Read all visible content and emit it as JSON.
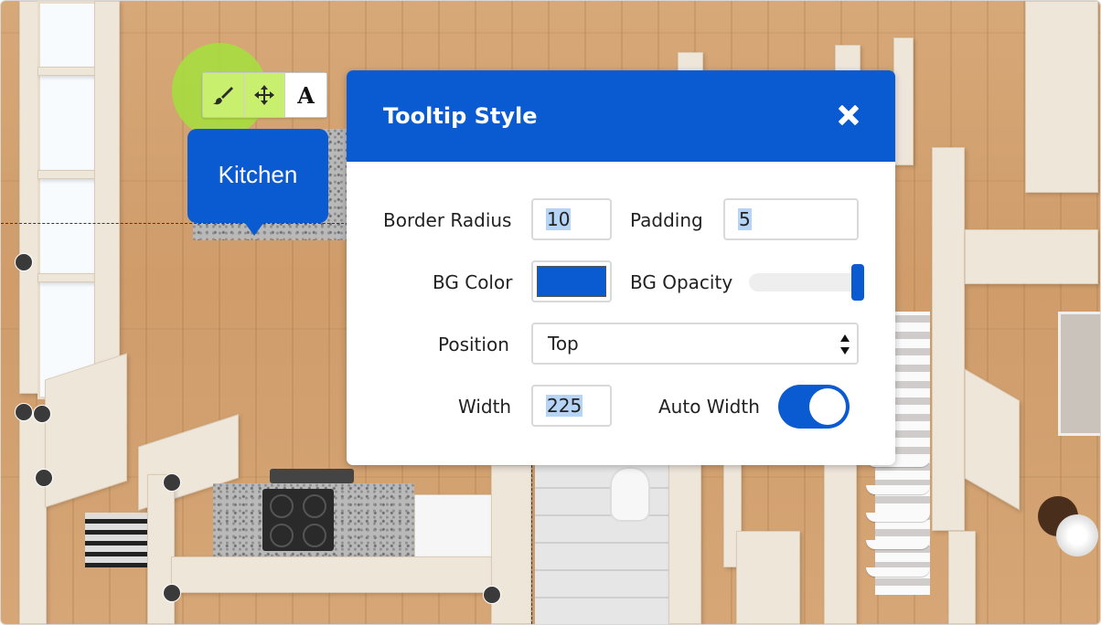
{
  "toolbar": {
    "style_icon": "paintbrush-icon",
    "move_icon": "move-arrows-icon",
    "text_label": "A"
  },
  "tooltip_preview": {
    "text": "Kitchen"
  },
  "dialog": {
    "title": "Tooltip Style",
    "close_icon": "close-icon",
    "fields": {
      "border_radius": {
        "label": "Border Radius",
        "value": "10"
      },
      "padding": {
        "label": "Padding",
        "value": "5"
      },
      "bg_color": {
        "label": "BG Color",
        "value": "#0a5ad1"
      },
      "bg_opacity": {
        "label": "BG Opacity",
        "value_percent": 100
      },
      "position": {
        "label": "Position",
        "value": "Top"
      },
      "width": {
        "label": "Width",
        "value": "225"
      },
      "auto_width": {
        "label": "Auto Width",
        "enabled": true
      }
    }
  },
  "colors": {
    "accent": "#0a5ad1",
    "highlight": "#a3e03c",
    "text_selection": "#b6d4f5"
  }
}
